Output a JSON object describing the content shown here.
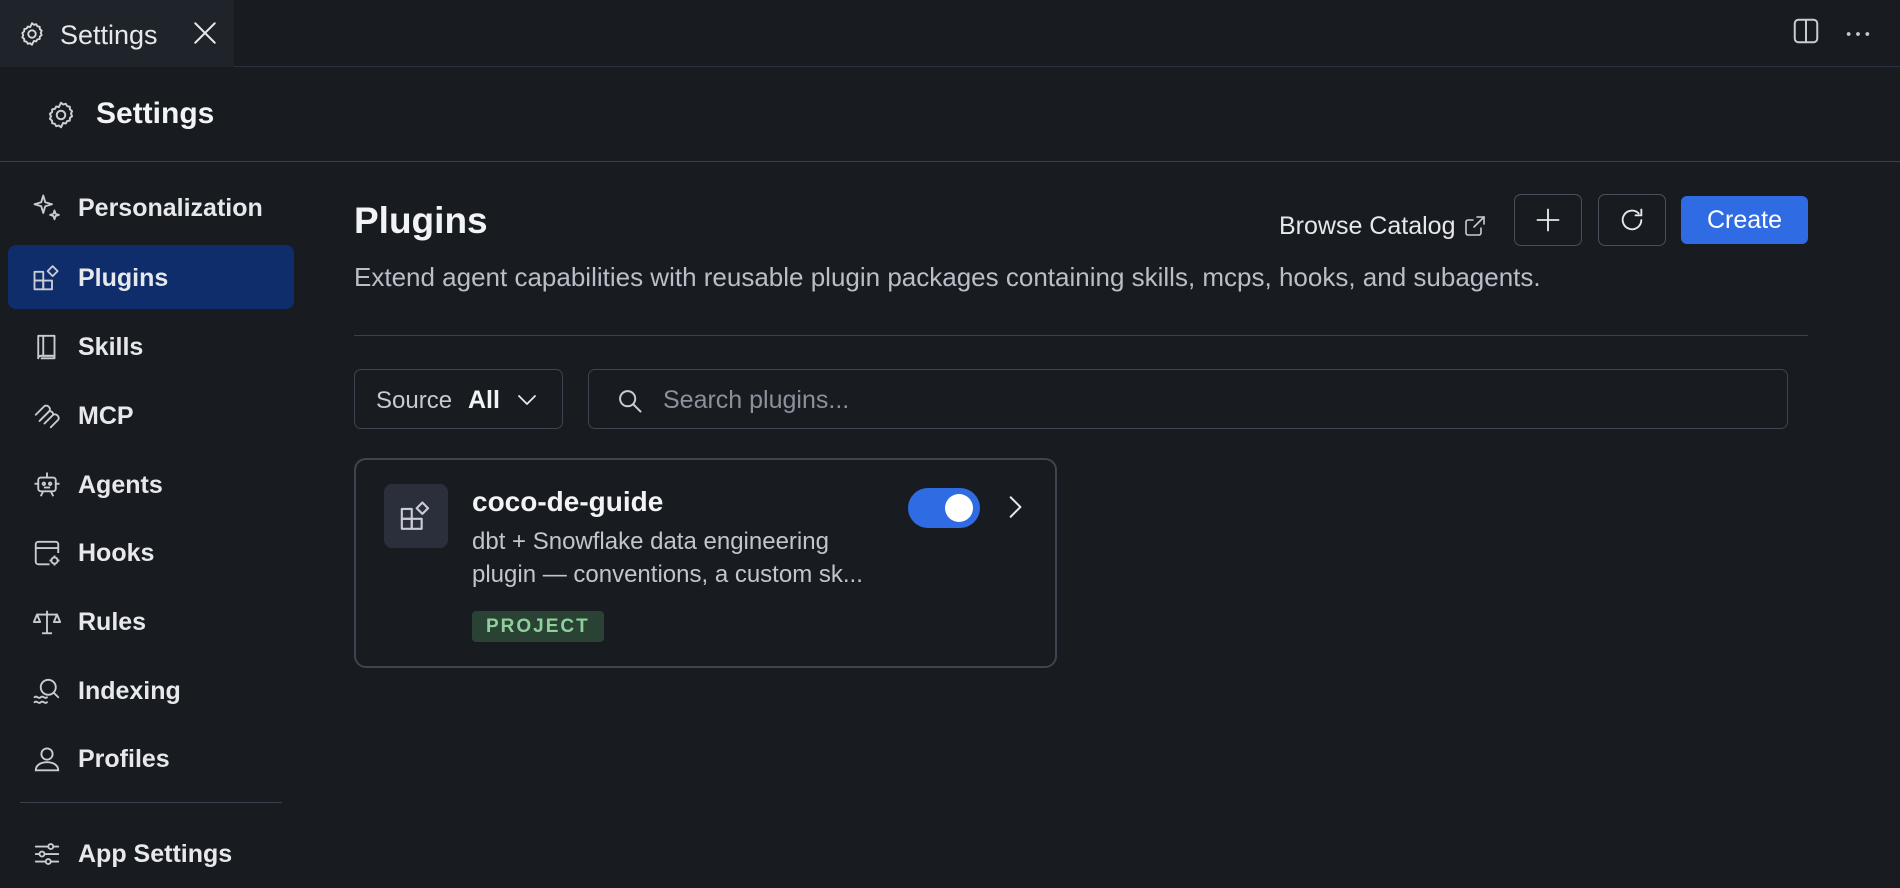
{
  "tab": {
    "label": "Settings"
  },
  "header": {
    "title": "Settings"
  },
  "sidebar": {
    "items": [
      {
        "label": "Personalization",
        "icon": "sparkles-icon"
      },
      {
        "label": "Plugins",
        "icon": "plugin-blocks-icon",
        "active": true
      },
      {
        "label": "Skills",
        "icon": "book-icon"
      },
      {
        "label": "MCP",
        "icon": "mcp-icon"
      },
      {
        "label": "Agents",
        "icon": "robot-icon"
      },
      {
        "label": "Hooks",
        "icon": "hooks-icon"
      },
      {
        "label": "Rules",
        "icon": "scale-icon"
      },
      {
        "label": "Indexing",
        "icon": "search-index-icon"
      },
      {
        "label": "Profiles",
        "icon": "person-icon"
      }
    ],
    "footer_item": {
      "label": "App Settings",
      "icon": "sliders-icon"
    }
  },
  "main": {
    "title": "Plugins",
    "description": "Extend agent capabilities with reusable plugin packages containing skills, mcps, hooks, and subagents.",
    "browse_label": "Browse Catalog",
    "create_label": "Create",
    "filter": {
      "label": "Source",
      "value": "All"
    },
    "search": {
      "placeholder": "Search plugins..."
    },
    "plugins": [
      {
        "name": "coco-de-guide",
        "description_line1": "dbt + Snowflake data engineering",
        "description_line2": "plugin — conventions, a custom sk...",
        "badge": "PROJECT",
        "enabled": true
      }
    ]
  },
  "colors": {
    "background": "#181b20",
    "accent": "#2f6ce3",
    "active_nav": "#0f2d6a",
    "badge_bg": "#294233",
    "badge_text": "#8fcf9c"
  }
}
